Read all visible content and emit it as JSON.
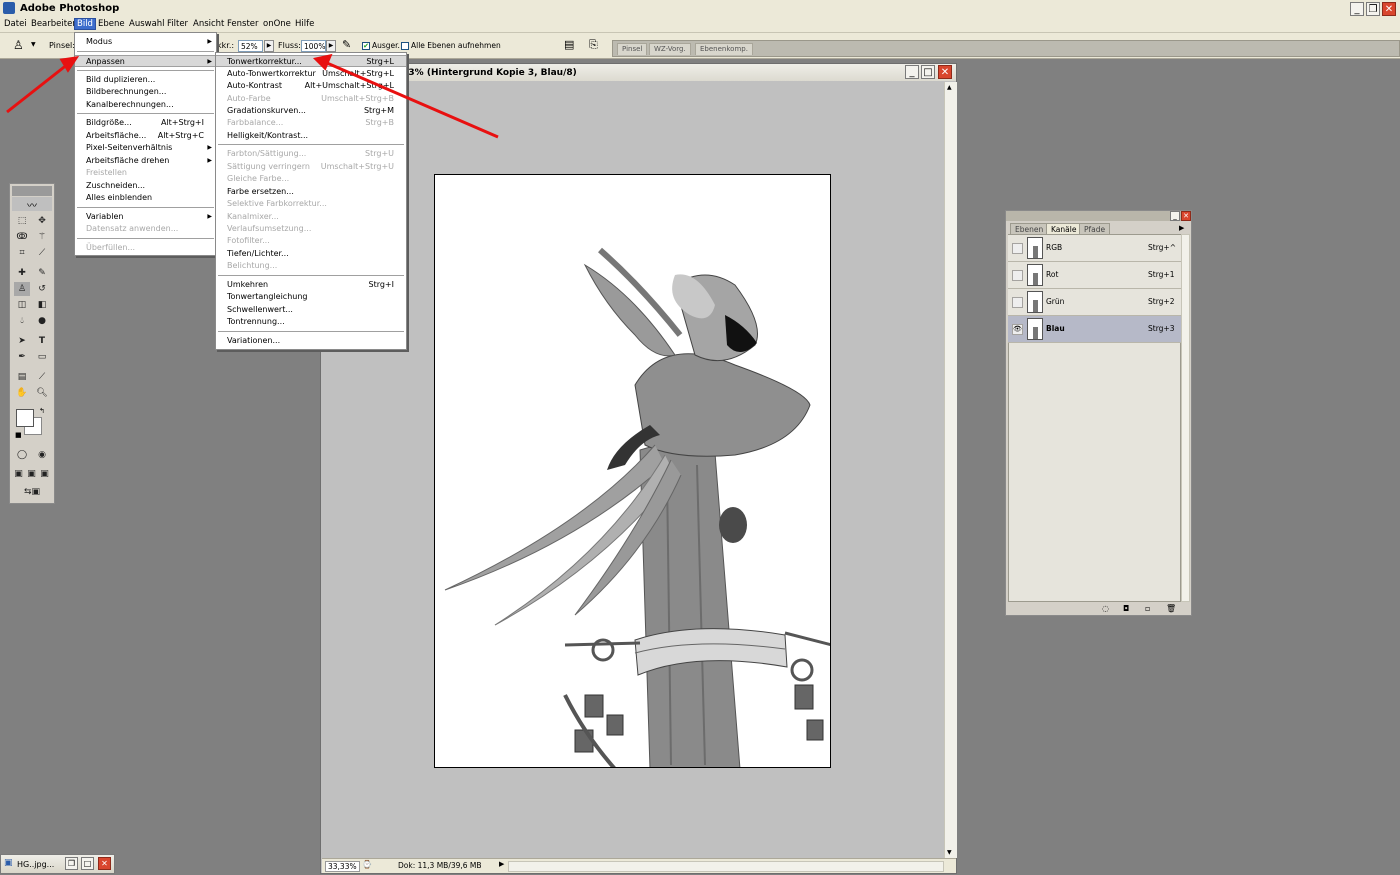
{
  "app": {
    "title": "Adobe Photoshop"
  },
  "menubar": [
    "Datei",
    "Bearbeiten",
    "Bild",
    "Ebene",
    "Auswahl",
    "Filter",
    "Ansicht",
    "Fenster",
    "onOne",
    "Hilfe"
  ],
  "options": {
    "brush_label": "Pinsel:",
    "opacity_label": "kkr.:",
    "opacity_value": "52%",
    "flow_label": "Fluss:",
    "flow_value": "100%",
    "sample_label": "Ausger.",
    "all_layers_label": "Alle Ebenen aufnehmen",
    "well_tabs": [
      "Pinsel",
      "WZ-Vorg.",
      "Ebenenkomp."
    ]
  },
  "document": {
    "title": ",3% (Hintergrund Kopie 3, Blau/8)",
    "zoom": "33,33%",
    "doc_info": "Dok: 11,3 MB/39,6 MB"
  },
  "bild_menu": {
    "items": [
      {
        "label": "Modus",
        "submenu": true
      },
      {
        "sep": true
      },
      {
        "label": "Anpassen",
        "submenu": true,
        "selected": true
      },
      {
        "sep": true
      },
      {
        "label": "Bild duplizieren..."
      },
      {
        "label": "Bildberechnungen..."
      },
      {
        "label": "Kanalberechnungen..."
      },
      {
        "sep": true
      },
      {
        "label": "Bildgröße...",
        "shortcut": "Alt+Strg+I"
      },
      {
        "label": "Arbeitsfläche...",
        "shortcut": "Alt+Strg+C"
      },
      {
        "label": "Pixel-Seitenverhältnis",
        "submenu": true
      },
      {
        "label": "Arbeitsfläche drehen",
        "submenu": true
      },
      {
        "label": "Freistellen",
        "disabled": true
      },
      {
        "label": "Zuschneiden..."
      },
      {
        "label": "Alles einblenden"
      },
      {
        "sep": true
      },
      {
        "label": "Variablen",
        "submenu": true
      },
      {
        "label": "Datensatz anwenden...",
        "disabled": true
      },
      {
        "sep": true
      },
      {
        "label": "Überfüllen...",
        "disabled": true
      }
    ]
  },
  "anpassen_menu": {
    "items": [
      {
        "label": "Tonwertkorrektur...",
        "shortcut": "Strg+L",
        "selected": true
      },
      {
        "label": "Auto-Tonwertkorrektur",
        "shortcut": "Umschalt+Strg+L"
      },
      {
        "label": "Auto-Kontrast",
        "shortcut": "Alt+Umschalt+Strg+L"
      },
      {
        "label": "Auto-Farbe",
        "shortcut": "Umschalt+Strg+B",
        "disabled": true
      },
      {
        "label": "Gradationskurven...",
        "shortcut": "Strg+M"
      },
      {
        "label": "Farbbalance...",
        "shortcut": "Strg+B",
        "disabled": true
      },
      {
        "label": "Helligkeit/Kontrast..."
      },
      {
        "sep": true
      },
      {
        "label": "Farbton/Sättigung...",
        "shortcut": "Strg+U",
        "disabled": true
      },
      {
        "label": "Sättigung verringern",
        "shortcut": "Umschalt+Strg+U",
        "disabled": true
      },
      {
        "label": "Gleiche Farbe...",
        "disabled": true
      },
      {
        "label": "Farbe ersetzen..."
      },
      {
        "label": "Selektive Farbkorrektur...",
        "disabled": true
      },
      {
        "label": "Kanalmixer...",
        "disabled": true
      },
      {
        "label": "Verlaufsumsetzung...",
        "disabled": true
      },
      {
        "label": "Fotofilter...",
        "disabled": true
      },
      {
        "label": "Tiefen/Lichter..."
      },
      {
        "label": "Belichtung...",
        "disabled": true
      },
      {
        "sep": true
      },
      {
        "label": "Umkehren",
        "shortcut": "Strg+I"
      },
      {
        "label": "Tonwertangleichung"
      },
      {
        "label": "Schwellenwert..."
      },
      {
        "label": "Tontrennung..."
      },
      {
        "sep": true
      },
      {
        "label": "Variationen..."
      }
    ]
  },
  "channels_panel": {
    "tabs": [
      "Ebenen",
      "Kanäle",
      "Pfade"
    ],
    "active_tab": "Kanäle",
    "channels": [
      {
        "name": "RGB",
        "shortcut": "Strg+^",
        "visible": false,
        "selected": false
      },
      {
        "name": "Rot",
        "shortcut": "Strg+1",
        "visible": false,
        "selected": false
      },
      {
        "name": "Grün",
        "shortcut": "Strg+2",
        "visible": false,
        "selected": false
      },
      {
        "name": "Blau",
        "shortcut": "Strg+3",
        "visible": true,
        "selected": true
      }
    ]
  },
  "minimized_window": {
    "title": "HG..jpg..."
  },
  "colors": {
    "annotation_arrow": "#e81010",
    "menu_highlight": "#3d6dcc",
    "app_bg": "#808080"
  }
}
